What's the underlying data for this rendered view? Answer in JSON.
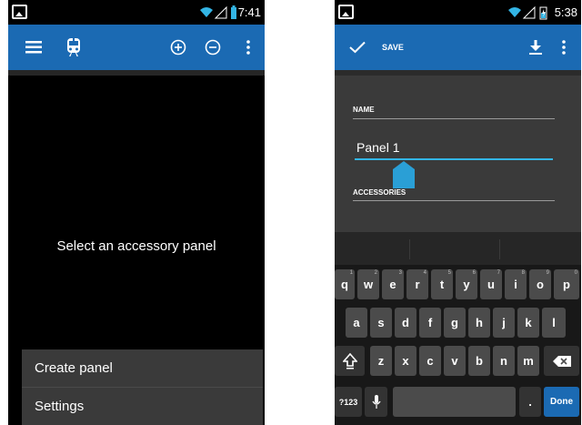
{
  "left_screen": {
    "status_bar": {
      "time": "7:41"
    },
    "action_bar": {
      "icons": [
        "menu-icon",
        "train-icon",
        "add-circle-icon",
        "remove-circle-icon",
        "overflow-icon"
      ]
    },
    "empty_message": "Select an accessory panel",
    "overflow_menu": {
      "items": [
        "Create panel",
        "Settings"
      ]
    }
  },
  "right_screen": {
    "status_bar": {
      "time": "5:38"
    },
    "action_bar": {
      "save_label": "SAVE",
      "icons": [
        "check-icon",
        "download-icon",
        "overflow-icon"
      ]
    },
    "form": {
      "name_label": "NAME",
      "name_value": "Panel 1",
      "accessories_label": "ACCESSORIES"
    },
    "keyboard": {
      "row1": [
        {
          "key": "q",
          "hint": "1"
        },
        {
          "key": "w",
          "hint": "2"
        },
        {
          "key": "e",
          "hint": "3"
        },
        {
          "key": "r",
          "hint": "4"
        },
        {
          "key": "t",
          "hint": "5"
        },
        {
          "key": "y",
          "hint": "6"
        },
        {
          "key": "u",
          "hint": "7"
        },
        {
          "key": "i",
          "hint": "8"
        },
        {
          "key": "o",
          "hint": "9"
        },
        {
          "key": "p",
          "hint": "0"
        }
      ],
      "row2": [
        "a",
        "s",
        "d",
        "f",
        "g",
        "h",
        "j",
        "k",
        "l"
      ],
      "row3": [
        "z",
        "x",
        "c",
        "v",
        "b",
        "n",
        "m"
      ],
      "symbols_label": "?123",
      "period_label": ".",
      "done_label": "Done"
    },
    "accent_color": "#1b6ab3",
    "input_focus_color": "#33b5e5"
  }
}
